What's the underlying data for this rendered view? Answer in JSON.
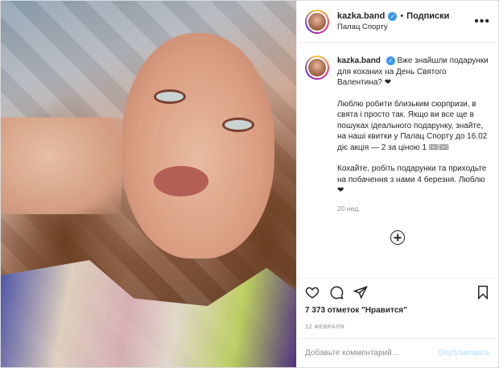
{
  "header": {
    "username": "kazka.band",
    "separator": "•",
    "follow_label": "Подписки",
    "location": "Палац Спорту"
  },
  "caption": {
    "username": "kazka.band",
    "paragraph1": "Вже знайшли подарунки для коханих на День Святого Валентина? ❤",
    "paragraph2": "Люблю робити близьким сюрпризи, в свята і просто так. Якщо ви все ще в пошуках ідеального подарунку, знайте, на наші квитки у Палац Спорту до 16.02 діє акція — 2 за ціною 1 🎟🎟",
    "paragraph3": "Кохайте, робіть подарунки та приходьте на побачення з нами 4 березня. Люблю ❤",
    "time_ago": "20 нед."
  },
  "footer": {
    "likes": "7 373 отметок \"Нравится\"",
    "date": "12 ФЕВРАЛЯ",
    "comment_placeholder": "Добавьте комментарий...",
    "publish_label": "Опубликовать"
  },
  "icons": {
    "like": "heart-icon",
    "comment": "comment-icon",
    "share": "share-icon",
    "save": "bookmark-icon",
    "more": "more-icon",
    "load_more": "plus-circle-icon",
    "verified": "verified-icon"
  },
  "colors": {
    "verified": "#3897f0",
    "publish_disabled": "#b2dffc",
    "muted": "#8e8e8e"
  }
}
